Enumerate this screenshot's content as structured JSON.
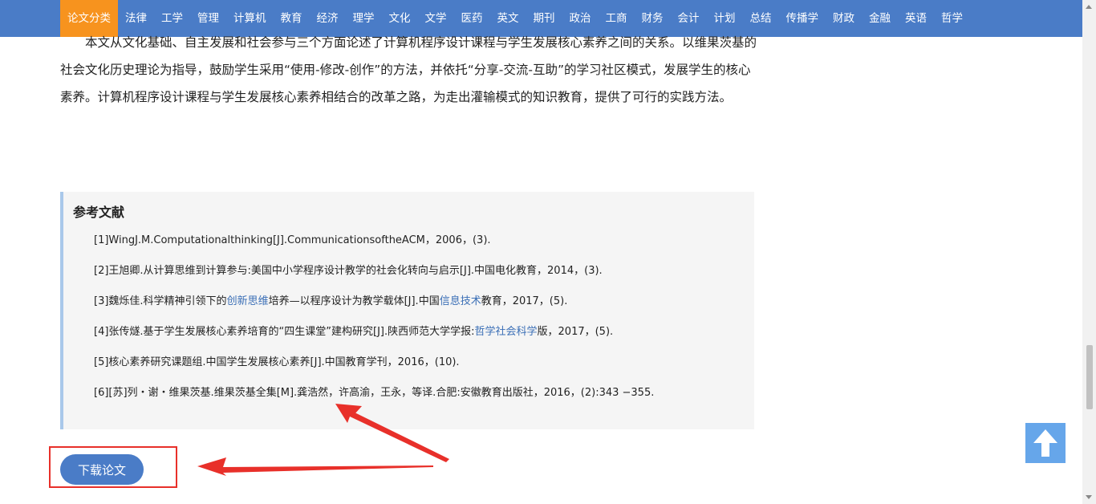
{
  "nav": {
    "items": [
      {
        "label": "论文分类",
        "active": true
      },
      {
        "label": "法律"
      },
      {
        "label": "工学"
      },
      {
        "label": "管理"
      },
      {
        "label": "计算机"
      },
      {
        "label": "教育"
      },
      {
        "label": "经济"
      },
      {
        "label": "理学"
      },
      {
        "label": "文化"
      },
      {
        "label": "文学"
      },
      {
        "label": "医药"
      },
      {
        "label": "英文"
      },
      {
        "label": "期刊"
      },
      {
        "label": "政治"
      },
      {
        "label": "工商"
      },
      {
        "label": "财务"
      },
      {
        "label": "会计"
      },
      {
        "label": "计划"
      },
      {
        "label": "总结"
      },
      {
        "label": "传播学"
      },
      {
        "label": "财政"
      },
      {
        "label": "金融"
      },
      {
        "label": "英语"
      },
      {
        "label": "哲学"
      }
    ]
  },
  "article": {
    "paragraph": "本文从文化基础、自主发展和社会参与三个方面论述了计算机程序设计课程与学生发展核心素养之间的关系。以维果茨基的社会文化历史理论为指导，鼓励学生采用“使用-修改-创作”的方法，并依托“分享-交流-互助”的学习社区模式，发展学生的核心素养。计算机程序设计课程与学生发展核心素养相结合的改革之路，为走出灌输模式的知识教育，提供了可行的实践方法。"
  },
  "references": {
    "title": "参考文献",
    "items": {
      "r1": {
        "text": "[1]WingJ.M.Computationalthinking[J].CommunicationsoftheACM，2006，(3)."
      },
      "r2": {
        "text": "[2]王旭卿.从计算思维到计算参与:美国中小学程序设计教学的社会化转向与启示[J].中国电化教育，2014，(3)."
      },
      "r3": {
        "a": "[3]魏烁佳.科学精神引领下的",
        "link1": "创新思维",
        "b": "培养—以程序设计为教学载体[J].中国",
        "link2": "信息技术",
        "c": "教育，2017，(5)."
      },
      "r4": {
        "a": "[4]张传燧.基于学生发展核心素养培育的“四生课堂”建构研究[J].陕西师范大学学报:",
        "link1": "哲学社会科学",
        "b": "版，2017，(5)."
      },
      "r5": {
        "text": "[5]核心素养研究课题组.中国学生发展核心素养[J].中国教育学刊，2016，(10)."
      },
      "r6": {
        "text": "[6][苏]列・谢・维果茨基.维果茨基全集[M].龚浩然，许高渝，王永，等译.合肥:安徽教育出版社，2016，(2):343 −355."
      }
    }
  },
  "download": {
    "label": "下载论文"
  },
  "colors": {
    "nav_bg": "#4a7cc7",
    "nav_active": "#f7931e",
    "annotation_red": "#e8302a",
    "backtop_bg": "#66a6ea",
    "link": "#3b6fb6"
  },
  "icons": {
    "backtop": "arrow-up-icon"
  }
}
